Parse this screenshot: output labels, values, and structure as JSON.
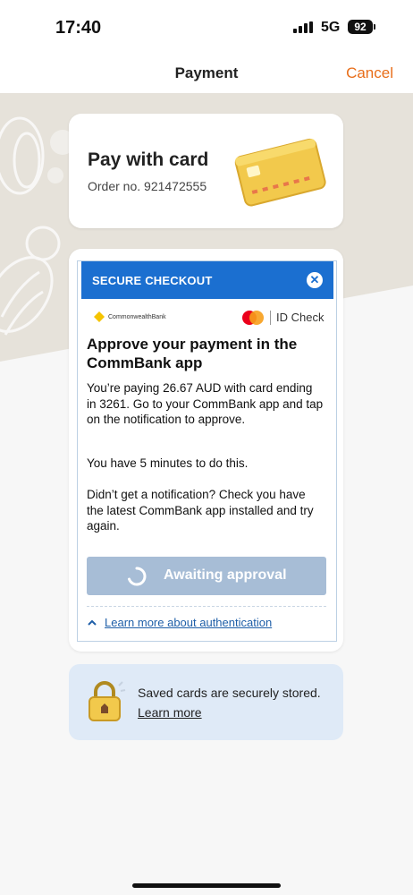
{
  "status_bar": {
    "time": "17:40",
    "network": "5G",
    "battery": "92"
  },
  "nav": {
    "title": "Payment",
    "cancel": "Cancel"
  },
  "card_panel": {
    "title": "Pay with card",
    "order_number": "Order no. 921472555"
  },
  "checkout": {
    "header": "SECURE CHECKOUT",
    "bank_name": "CommonwealthBank",
    "id_check": "ID Check",
    "title": "Approve your payment in the CommBank app",
    "paragraph1": "You’re paying 26.67 AUD with card ending in 3261. Go to your CommBank app and tap on the notification to approve.",
    "paragraph2": "You have 5 minutes to do this.",
    "paragraph3": "Didn’t get a notification? Check you have the latest CommBank app installed and try again.",
    "button": "Awaiting approval",
    "learn_more": "Learn more about authentication"
  },
  "saved": {
    "text": "Saved cards are securely stored.",
    "link": "Learn more"
  },
  "colors": {
    "accent": "#e86e1a",
    "checkout_blue": "#1b6fd0",
    "button_disabled": "#a7bdd6",
    "info_bg": "#dfeaf7"
  }
}
